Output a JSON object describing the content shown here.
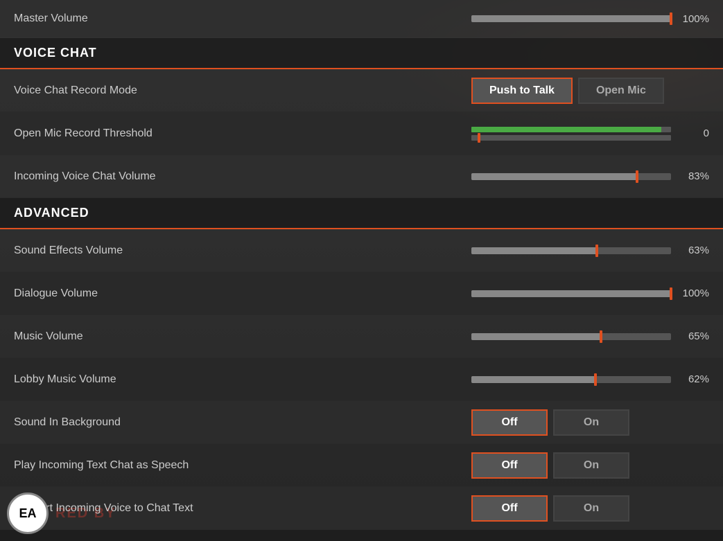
{
  "masterVolume": {
    "label": "Master Volume",
    "value": 100,
    "valueText": "100%",
    "fillPercent": 100
  },
  "voiceChat": {
    "sectionLabel": "VOICE CHAT",
    "rows": [
      {
        "id": "voice-chat-record-mode",
        "label": "Voice Chat Record Mode",
        "type": "toggle2",
        "options": [
          "Push to Talk",
          "Open Mic"
        ],
        "selected": "Push to Talk"
      },
      {
        "id": "open-mic-threshold",
        "label": "Open Mic Record Threshold",
        "type": "threshold",
        "value": 0,
        "valueText": "0"
      },
      {
        "id": "incoming-voice-volume",
        "label": "Incoming Voice Chat Volume",
        "type": "slider",
        "value": 83,
        "valueText": "83%",
        "fillPercent": 83
      }
    ]
  },
  "advanced": {
    "sectionLabel": "ADVANCED",
    "rows": [
      {
        "id": "sound-effects-volume",
        "label": "Sound Effects Volume",
        "type": "slider",
        "value": 63,
        "valueText": "63%",
        "fillPercent": 63
      },
      {
        "id": "dialogue-volume",
        "label": "Dialogue Volume",
        "type": "slider",
        "value": 100,
        "valueText": "100%",
        "fillPercent": 100
      },
      {
        "id": "music-volume",
        "label": "Music Volume",
        "type": "slider",
        "value": 65,
        "valueText": "65%",
        "fillPercent": 65
      },
      {
        "id": "lobby-music-volume",
        "label": "Lobby Music Volume",
        "type": "slider",
        "value": 62,
        "valueText": "62%",
        "fillPercent": 62
      },
      {
        "id": "sound-in-background",
        "label": "Sound In Background",
        "type": "toggle2",
        "options": [
          "Off",
          "On"
        ],
        "selected": "Off"
      },
      {
        "id": "play-incoming-text",
        "label": "Play Incoming Text Chat as Speech",
        "type": "toggle2",
        "options": [
          "Off",
          "On"
        ],
        "selected": "Off"
      },
      {
        "id": "convert-incoming-voice",
        "label": "Convert Incoming Voice to Chat Text",
        "type": "toggle2",
        "options": [
          "Off",
          "On"
        ],
        "selected": "Off"
      }
    ]
  },
  "eaLogo": "EA",
  "redBannerText": "RED BY"
}
